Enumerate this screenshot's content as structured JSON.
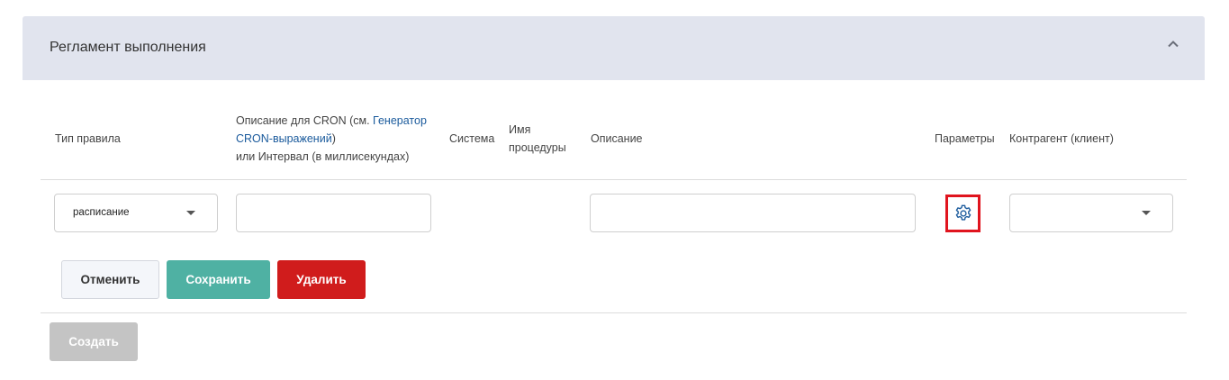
{
  "section": {
    "title": "Регламент выполнения",
    "collapse_icon": "chevron-up-icon"
  },
  "table": {
    "headers": {
      "rule_type": "Тип правила",
      "cron_prefix": "Описание для CRON (см. ",
      "cron_link_line1": "Генератор",
      "cron_link_line2": "CRON-выражений",
      "cron_close": ")",
      "cron_line3": "или Интервал (в миллисекундах)",
      "system": "Система",
      "procedure_line1": "Имя",
      "procedure_line2": "процедуры",
      "description": "Описание",
      "parameters": "Параметры",
      "counterparty": "Контрагент (клиент)"
    },
    "row": {
      "rule_type_value": "расписание",
      "cron_value": "",
      "description_value": "",
      "parameters_icon": "gear-icon",
      "counterparty_value": ""
    }
  },
  "buttons": {
    "cancel": "Отменить",
    "save": "Сохранить",
    "delete": "Удалить",
    "create": "Создать"
  },
  "colors": {
    "header_bg": "#e1e4ee",
    "link": "#1a5a9c",
    "save": "#4fb1a3",
    "delete": "#d01c1c",
    "disabled": "#c4c4c4",
    "highlight": "#e0141e"
  }
}
